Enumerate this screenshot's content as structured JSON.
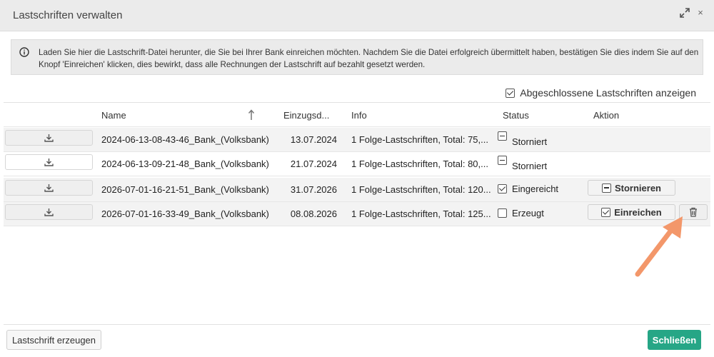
{
  "dialog": {
    "title": "Lastschriften verwalten",
    "maximize_icon": "expand-icon",
    "close_label": "×"
  },
  "info": {
    "text": "Laden Sie hier die Lastschrift-Datei herunter, die Sie bei Ihrer Bank einreichen möchten. Nachdem Sie die Datei erfolgreich übermittelt haben, bestätigen Sie dies indem Sie auf den Knopf 'Einreichen' klicken, dies bewirkt, dass alle Rechnungen der Lastschrift auf bezahlt gesetzt werden."
  },
  "filter": {
    "show_closed_label": "Abgeschlossene Lastschriften anzeigen",
    "show_closed_checked": true
  },
  "table": {
    "headers": {
      "name": "Name",
      "date": "Einzugsd...",
      "info": "Info",
      "status": "Status",
      "action": "Aktion"
    },
    "rows": [
      {
        "name": "2024-06-13-08-43-46_Bank_(Volksbank)",
        "date": "13.07.2024",
        "info": "1 Folge-Lastschriften, Total: 75,...",
        "status": "Storniert",
        "status_icon": "minus"
      },
      {
        "name": "2024-06-13-09-21-48_Bank_(Volksbank)",
        "date": "21.07.2024",
        "info": "1 Folge-Lastschriften, Total: 80,...",
        "status": "Storniert",
        "status_icon": "minus"
      },
      {
        "name": "2026-07-01-16-21-51_Bank_(Volksbank)",
        "date": "31.07.2026",
        "info": "1 Folge-Lastschriften, Total: 120...",
        "status": "Eingereicht",
        "status_icon": "checked",
        "action_label": "Stornieren"
      },
      {
        "name": "2026-07-01-16-33-49_Bank_(Volksbank)",
        "date": "08.08.2026",
        "info": "1 Folge-Lastschriften, Total: 125...",
        "status": "Erzeugt",
        "status_icon": "unchecked",
        "action_label": "Einreichen"
      }
    ]
  },
  "footer": {
    "create_label": "Lastschrift erzeugen",
    "close_label": "Schließen"
  },
  "colors": {
    "primary": "#26a686",
    "annotation_arrow": "#f3976a",
    "info_bg": "#ebebeb"
  }
}
